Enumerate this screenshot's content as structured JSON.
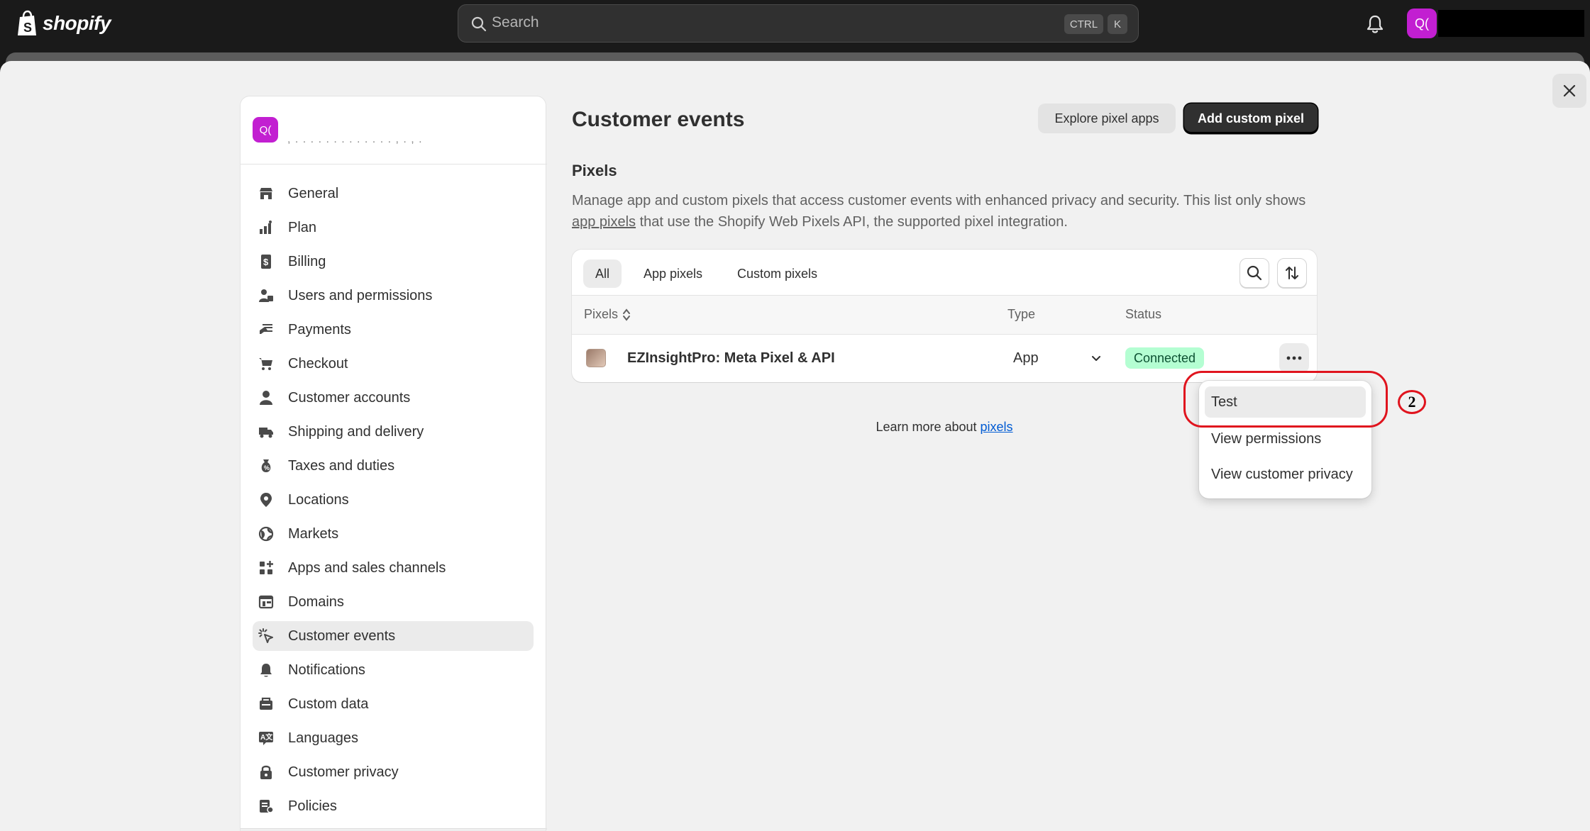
{
  "topbar": {
    "logo_text": "shopify",
    "search_placeholder": "Search",
    "shortcut_ctrl": "CTRL",
    "shortcut_k": "K",
    "avatar_initials": "Q("
  },
  "store": {
    "avatar_initials": "Q("
  },
  "sidebar": {
    "items": [
      {
        "label": "General",
        "icon": "store-icon"
      },
      {
        "label": "Plan",
        "icon": "plan-icon"
      },
      {
        "label": "Billing",
        "icon": "billing-icon"
      },
      {
        "label": "Users and permissions",
        "icon": "users-icon"
      },
      {
        "label": "Payments",
        "icon": "payments-icon"
      },
      {
        "label": "Checkout",
        "icon": "cart-icon"
      },
      {
        "label": "Customer accounts",
        "icon": "person-icon"
      },
      {
        "label": "Shipping and delivery",
        "icon": "truck-icon"
      },
      {
        "label": "Taxes and duties",
        "icon": "tax-icon"
      },
      {
        "label": "Locations",
        "icon": "location-icon"
      },
      {
        "label": "Markets",
        "icon": "globe-icon"
      },
      {
        "label": "Apps and sales channels",
        "icon": "apps-icon"
      },
      {
        "label": "Domains",
        "icon": "domains-icon"
      },
      {
        "label": "Customer events",
        "icon": "cursor-click-icon",
        "active": true
      },
      {
        "label": "Notifications",
        "icon": "bell-icon"
      },
      {
        "label": "Custom data",
        "icon": "data-icon"
      },
      {
        "label": "Languages",
        "icon": "language-icon"
      },
      {
        "label": "Customer privacy",
        "icon": "lock-icon"
      },
      {
        "label": "Policies",
        "icon": "policy-icon"
      }
    ]
  },
  "main": {
    "title": "Customer events",
    "explore_button": "Explore pixel apps",
    "add_button": "Add custom pixel",
    "section_title": "Pixels",
    "desc_before": "Manage app and custom pixels that access customer events with enhanced privacy and security. This list only shows ",
    "desc_link": "app pixels",
    "desc_after": " that use the Shopify Web Pixels API, the supported pixel integration.",
    "tabs": [
      "All",
      "App pixels",
      "Custom pixels"
    ],
    "columns": {
      "pixels": "Pixels",
      "type": "Type",
      "status": "Status"
    },
    "rows": [
      {
        "name": "EZInsightPro: Meta Pixel & API",
        "type": "App",
        "status": "Connected"
      }
    ],
    "learn_prefix": "Learn more about ",
    "learn_link": "pixels"
  },
  "menu": {
    "items": [
      "Test",
      "View permissions",
      "View customer privacy"
    ]
  },
  "annotation": {
    "number": "2"
  },
  "colors": {
    "accent_dark": "#303030",
    "badge_bg": "#b4fed2",
    "avatar": "#c21fd1",
    "annotation": "#e0141e",
    "link": "#005bd3"
  }
}
